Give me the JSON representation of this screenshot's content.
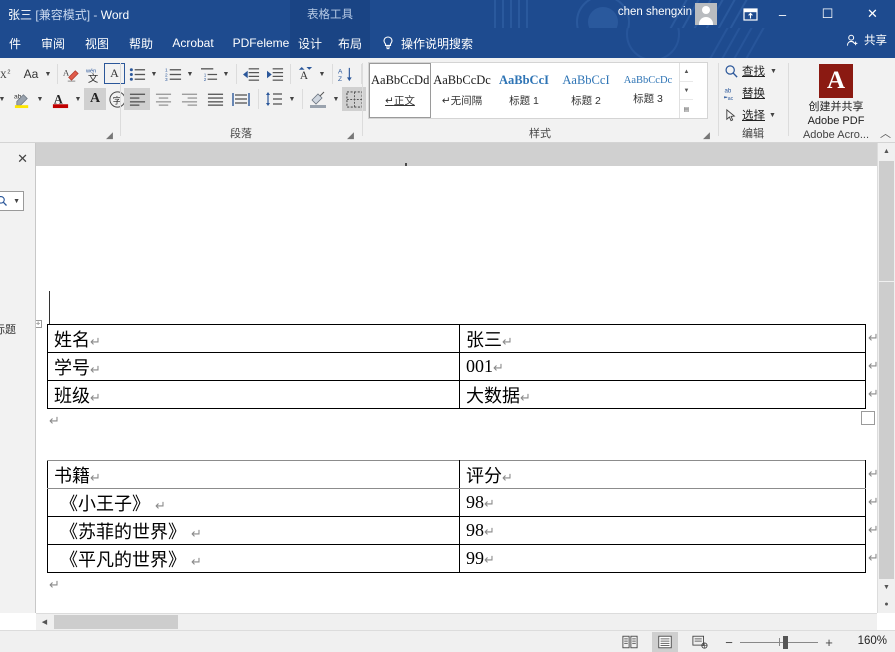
{
  "window": {
    "title_main": "张三",
    "title_mode": "[兼容模式]",
    "title_dash": "-",
    "title_app": "Word",
    "contextual_tab_group": "表格工具",
    "user_name": "chen shengxin",
    "avatar_icon": "user-avatar-icon",
    "ribbon_display_icon": "ribbon-display-options-icon",
    "minimize_icon": "–",
    "maximize_icon": "☐",
    "close_icon": "✕"
  },
  "tabs": [
    {
      "label": "件",
      "contextual": false
    },
    {
      "label": "审阅",
      "contextual": false
    },
    {
      "label": "视图",
      "contextual": false
    },
    {
      "label": "帮助",
      "contextual": false
    },
    {
      "label": "Acrobat",
      "contextual": false
    },
    {
      "label": "PDFelement",
      "contextual": false
    },
    {
      "label": "设计",
      "contextual": true
    },
    {
      "label": "布局",
      "contextual": true
    }
  ],
  "tell_me": {
    "label": "操作说明搜索",
    "icon": "lightbulb-icon"
  },
  "share": {
    "label": "共享",
    "icon": "share-person-icon"
  },
  "ribbon": {
    "groups": [
      {
        "name": "font",
        "title": ""
      },
      {
        "name": "paragraph",
        "title": "段落"
      },
      {
        "name": "styles",
        "title": "样式"
      },
      {
        "name": "editing",
        "title": "编辑"
      },
      {
        "name": "adobe",
        "title": "Adobe Acro..."
      }
    ],
    "font_buttons": [
      {
        "name": "change-case-icon",
        "label": "Aa"
      },
      {
        "name": "clear-formatting-icon",
        "label": ""
      },
      {
        "name": "phonetic-guide-icon",
        "label": ""
      },
      {
        "name": "character-border-icon",
        "label": "A"
      },
      {
        "name": "text-highlight-color-icon",
        "label": ""
      },
      {
        "name": "font-color-icon",
        "label": "A"
      },
      {
        "name": "text-effects-icon",
        "label": "A"
      },
      {
        "name": "enclose-characters-icon",
        "label": "字"
      }
    ],
    "paragraph_buttons": [
      {
        "name": "bullets-icon"
      },
      {
        "name": "numbering-icon"
      },
      {
        "name": "multilevel-list-icon"
      },
      {
        "name": "decrease-indent-icon"
      },
      {
        "name": "increase-indent-icon"
      },
      {
        "name": "sort-icon"
      },
      {
        "name": "sort-az-icon"
      },
      {
        "name": "show-formatting-marks-icon"
      },
      {
        "name": "align-left-icon"
      },
      {
        "name": "align-center-icon"
      },
      {
        "name": "align-right-icon"
      },
      {
        "name": "justify-icon"
      },
      {
        "name": "distributed-icon"
      },
      {
        "name": "line-spacing-icon"
      },
      {
        "name": "shading-icon"
      },
      {
        "name": "borders-icon"
      }
    ],
    "styles": [
      {
        "preview": "AaBbCcDdI",
        "name": "正文",
        "active": true,
        "mark": "↵"
      },
      {
        "preview": "AaBbCcDc",
        "name": "无间隔",
        "active": false,
        "mark": "↵"
      },
      {
        "preview": "AaBbCcI",
        "name": "标题 1",
        "active": false,
        "mark": ""
      },
      {
        "preview": "AaBbCcI",
        "name": "标题 2",
        "active": false,
        "mark": ""
      },
      {
        "preview": "AaBbCcDc",
        "name": "标题 3",
        "active": false,
        "mark": ""
      }
    ],
    "editing": [
      {
        "label": "查找",
        "icon": "search-icon",
        "has_caret": true
      },
      {
        "label": "替换",
        "icon": "replace-abc-icon",
        "has_caret": false
      },
      {
        "label": "选择",
        "icon": "select-pointer-icon",
        "has_caret": true
      }
    ],
    "adobe": {
      "icon": "adobe-pdf-icon",
      "label_line1": "创建并共享",
      "label_line2": "Adobe PDF"
    },
    "collapse_icon": "chevron-up-icon"
  },
  "nav_pane": {
    "close_icon": "close-icon",
    "search_icon": "search-icon",
    "search_caret_icon": "chevron-down-icon",
    "heading_label": "标题"
  },
  "document": {
    "paragraph_mark": "↵",
    "table1": {
      "rows": [
        {
          "label": "姓名",
          "value": "张三"
        },
        {
          "label": "学号",
          "value": "001"
        },
        {
          "label": "班级",
          "value": "大数据"
        }
      ]
    },
    "table2": {
      "rows": [
        {
          "label": "书籍",
          "value": "评分"
        },
        {
          "label": "《小王子》",
          "value": "98"
        },
        {
          "label": "《苏菲的世界》",
          "value": "98"
        },
        {
          "label": "《平凡的世界》",
          "value": "99"
        }
      ]
    }
  },
  "status_bar": {
    "views": [
      {
        "name": "read-mode-icon",
        "active": false
      },
      {
        "name": "print-layout-icon",
        "active": true
      },
      {
        "name": "web-layout-icon",
        "active": false
      }
    ],
    "zoom_out": "−",
    "zoom_in": "+",
    "zoom_level": "160%"
  },
  "colors": {
    "title_bar": "#1e4b8f",
    "contextual_tab": "#1a4484",
    "ribbon_bg": "#f2f2f2",
    "style_blue": "#2e74b5",
    "adobe_red": "#8b1a12",
    "doc_gray": "#7a7a7a"
  }
}
